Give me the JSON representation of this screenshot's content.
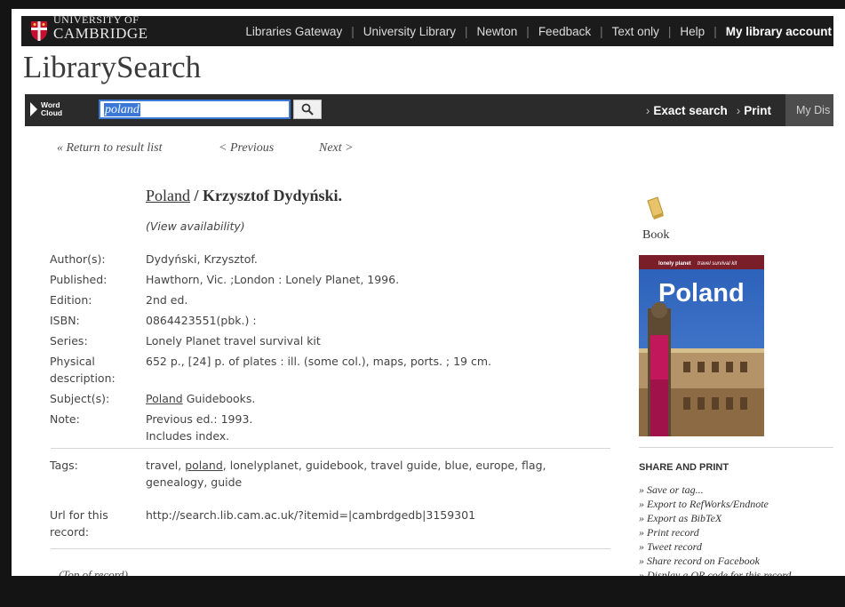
{
  "header": {
    "logo_top": "UNIVERSITY OF",
    "logo_bottom": "CAMBRIDGE",
    "links": [
      "Libraries Gateway",
      "University Library",
      "Newton",
      "Feedback",
      "Text only",
      "Help"
    ],
    "account": "My library account"
  },
  "brand": "LibrarySearch",
  "searchbar": {
    "word_cloud_line1": "Word",
    "word_cloud_line2": "Cloud",
    "query": "poland",
    "exact_search": "Exact search",
    "print": "Print",
    "my_discovery": "My Dis"
  },
  "nav": {
    "return": "« Return to result list",
    "previous": "< Previous",
    "next": "Next >"
  },
  "record": {
    "title_link": "Poland",
    "title_rest": " / Krzysztof Dydyński.",
    "availability": "(View availability)",
    "author_label": "Author(s):",
    "author": "Dydyński, Krzysztof.",
    "published_label": "Published:",
    "published": "Hawthorn, Vic. ;London : Lonely Planet, 1996.",
    "edition_label": "Edition:",
    "edition": "2nd ed.",
    "isbn_label": "ISBN:",
    "isbn": "0864423551(pbk.) :",
    "series_label": "Series:",
    "series": "Lonely Planet travel survival kit",
    "physical_label_1": "Physical",
    "physical_label_2": "description:",
    "physical": "652 p., [24] p. of plates : ill. (some col.), maps, ports. ; 19 cm.",
    "subject_label": "Subject(s):",
    "subject_link": "Poland",
    "subject_rest": " Guidebooks.",
    "note_label": "Note:",
    "note_1": "Previous ed.: 1993.",
    "note_2": "Includes index.",
    "tags_label": "Tags:",
    "tags_pre": "travel, ",
    "tags_link": "poland",
    "tags_post": ", lonelyplanet, guidebook, travel guide, blue, europe, flag,",
    "tags_line2": "genealogy, guide",
    "url_label_1": "Url for this",
    "url_label_2": "record:",
    "url": "http://search.lib.cam.ac.uk/?itemid=|cambrdgedb|3159301",
    "top_of_record": "(Top of record)"
  },
  "sidebar": {
    "format": "Book",
    "cover_brand": "lonely planet",
    "cover_series": "travel survival kit",
    "cover_title": "Poland",
    "share_heading": "SHARE AND PRINT",
    "share_items": [
      "» Save or tag...",
      "» Export to RefWorks/Endnote",
      "» Export as BibTeX",
      "» Print record",
      "» Tweet record",
      "» Share record on Facebook",
      "» Display a QR code for this record"
    ]
  }
}
